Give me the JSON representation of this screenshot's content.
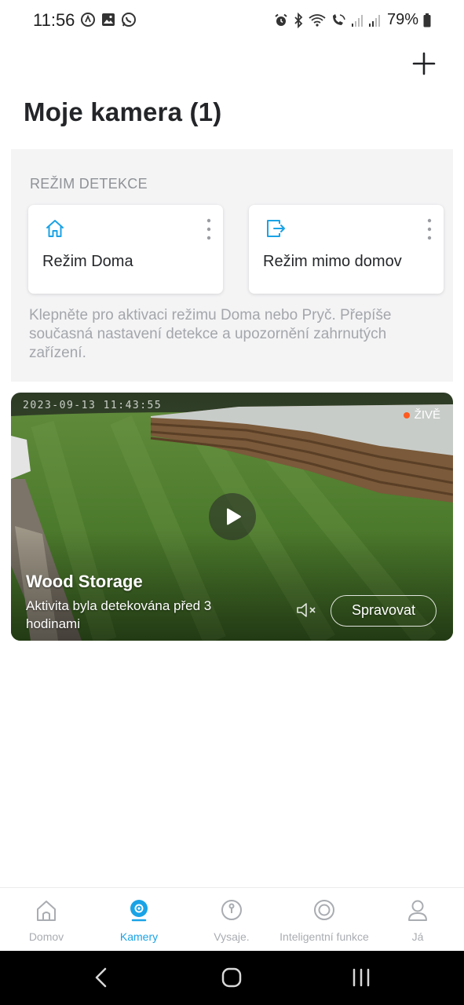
{
  "status_bar": {
    "time": "11:56",
    "battery": "79%",
    "left_icons": [
      "data-saver-icon",
      "gallery-icon",
      "whatsapp-icon"
    ],
    "right_icons": [
      "alarm-icon",
      "bluetooth-icon",
      "wifi-call-icon",
      "volte-call-icon",
      "signal-icon",
      "signal-icon",
      "battery-icon"
    ]
  },
  "header": {
    "title": "Moje kamera (1)"
  },
  "detection": {
    "title": "REŽIM DETEKCE",
    "modes": [
      {
        "label": "Režim Doma",
        "icon": "home-icon"
      },
      {
        "label": "Režim mimo domov",
        "icon": "exit-icon"
      }
    ],
    "description": "Klepněte pro aktivaci režimu Doma nebo Pryč. Přepíše současná nastavení detekce a upozornění zahrnutých zařízení."
  },
  "camera": {
    "timestamp": "2023-09-13 11:43:55",
    "live_label": "ŽIVĚ",
    "name": "Wood Storage",
    "activity": "Aktivita byla detekována před 3 hodinami",
    "manage_label": "Spravovat"
  },
  "bottom_nav": {
    "items": [
      {
        "label": "Domov",
        "icon": "home-icon",
        "active": false
      },
      {
        "label": "Kamery",
        "icon": "camera-icon",
        "active": true
      },
      {
        "label": "Vysaje.",
        "icon": "robot-vacuum-icon",
        "active": false
      },
      {
        "label": "Inteligentní funkce",
        "icon": "smart-functions-icon",
        "active": false
      },
      {
        "label": "Já",
        "icon": "user-icon",
        "active": false
      }
    ]
  },
  "colors": {
    "accent": "#1aa3e6",
    "live_dot": "#ff5a1f",
    "nav_inactive": "#a9acb1",
    "section_bg": "#f4f4f5"
  }
}
